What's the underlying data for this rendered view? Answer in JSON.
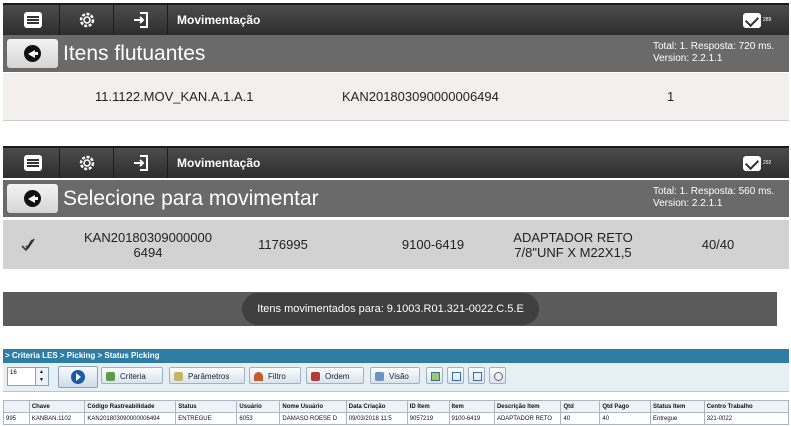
{
  "screen1": {
    "app_title": "Movimentação",
    "notif_count": "289",
    "heading": "Itens flutuantes",
    "info_line1": "Total: 1. Resposta: 720 ms.",
    "info_line2": "Version: 2.2.1.1",
    "row": {
      "location": "11.1122.MOV_KAN.A.1.A.1",
      "kanban": "KAN201803090000006494",
      "qty": "1"
    }
  },
  "screen2": {
    "app_title": "Movimentação",
    "notif_count": "292",
    "heading": "Selecione para movimentar",
    "info_line1": "Total: 1. Resposta: 560 ms.",
    "info_line2": "Version: 2.2.1.1",
    "row": {
      "kanban_line1": "KAN20180309000000",
      "kanban_line2": "6494",
      "code": "1176995",
      "item": "9100-6419",
      "desc_line1": "ADAPTADOR RETO",
      "desc_line2": "7/8\"UNF X M22X1,5",
      "qty": "40/40"
    }
  },
  "toast": {
    "text": "Itens movimentados para: 9.1003.R01.321-0022.C.5.E"
  },
  "les": {
    "breadcrumb": "> Criteria LES > Picking > Status Picking",
    "page_size": "16",
    "buttons": {
      "criteria": "Criteria",
      "parametros": "Parâmetros",
      "filtro": "Filtro",
      "ordem": "Ordem",
      "visao": "Visão"
    },
    "columns": [
      "",
      "Chave",
      "Código Rastreabilidade",
      "Status",
      "Usuário",
      "Nome Usuário",
      "Data Criação",
      "ID Item",
      "Item",
      "Descrição Item",
      "Qtd",
      "Qtd Pago",
      "Status Item",
      "Centro Trabalho"
    ],
    "rows": [
      [
        "995",
        "KANBAN.1102",
        "KAN201803090000006494",
        "ENTREGUE",
        "6053",
        "DAMASO ROESE D",
        "09/03/2018 11:5",
        "9057219",
        "9100-6419",
        "ADAPTADOR RETO",
        "40",
        "40",
        "Entregue",
        "321-0022"
      ]
    ]
  }
}
